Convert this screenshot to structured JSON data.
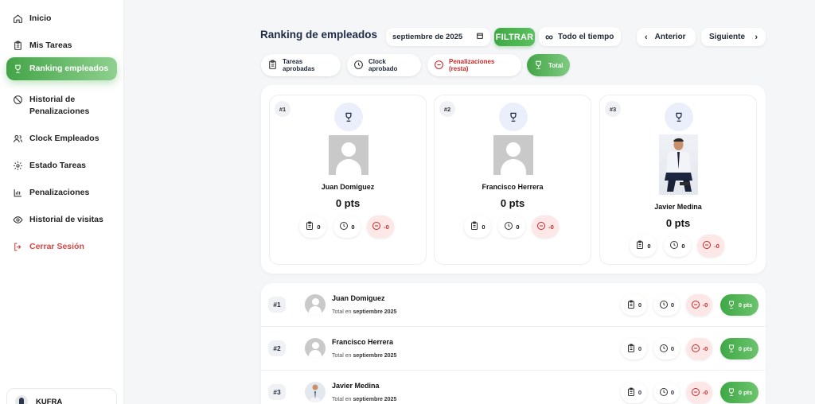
{
  "sidebar": {
    "items": [
      {
        "label": "Inicio",
        "icon": "home-icon"
      },
      {
        "label": "Mis Tareas",
        "icon": "clipboard-icon"
      },
      {
        "label": "Ranking empleados",
        "icon": "trophy-icon",
        "active": true
      },
      {
        "label": "Historial de Penalizaciones",
        "icon": "ban-icon"
      },
      {
        "label": "Clock Empleados",
        "icon": "users-icon"
      },
      {
        "label": "Estado Tareas",
        "icon": "gear-icon"
      },
      {
        "label": "Penalizaciones",
        "icon": "bar-chart-icon"
      },
      {
        "label": "Historial de visitas",
        "icon": "eye-icon"
      },
      {
        "label": "Cerrar Sesión",
        "icon": "logout-icon"
      }
    ],
    "user": {
      "name": "KUFRA"
    }
  },
  "header": {
    "title": "Ranking de empleados",
    "month_value": "septiembre de 2025",
    "filter_label": "FILTRAR",
    "all_time_label": "Todo el tiempo",
    "prev_label": "Anterior",
    "next_label": "Siguiente"
  },
  "filters": {
    "tasks": "Tareas aprobadas",
    "clock": "Clock aprobado",
    "penalties": "Penalizaciones (resta)",
    "total": "Total"
  },
  "podium": [
    {
      "rank": "#1",
      "name": "Juan Domiguez",
      "points": "0 pts",
      "tasks": "0",
      "clock": "0",
      "penalty": "-0"
    },
    {
      "rank": "#2",
      "name": "Francisco Herrera",
      "points": "0 pts",
      "tasks": "0",
      "clock": "0",
      "penalty": "-0"
    },
    {
      "rank": "#3",
      "name": "Javier Medina",
      "points": "0 pts",
      "tasks": "0",
      "clock": "0",
      "penalty": "-0"
    }
  ],
  "table": {
    "total_prefix": "Total en",
    "period": "septiembre 2025",
    "rows": [
      {
        "rank": "#1",
        "name": "Juan Domiguez",
        "tasks": "0",
        "clock": "0",
        "penalty": "-0",
        "total": "0 pts"
      },
      {
        "rank": "#2",
        "name": "Francisco Herrera",
        "tasks": "0",
        "clock": "0",
        "penalty": "-0",
        "total": "0 pts"
      },
      {
        "rank": "#3",
        "name": "Javier Medina",
        "tasks": "0",
        "clock": "0",
        "penalty": "-0",
        "total": "0 pts"
      }
    ]
  },
  "colors": {
    "accent": "#43a447",
    "danger": "#c62828",
    "danger_bg": "#fde7e7"
  }
}
